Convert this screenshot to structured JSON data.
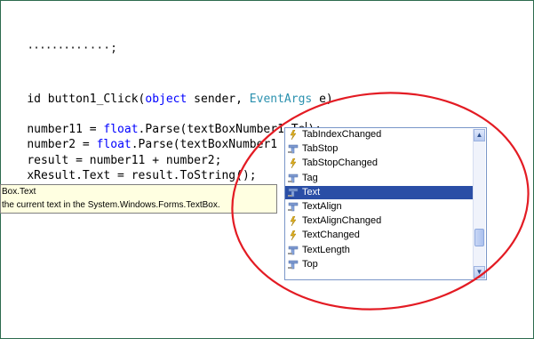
{
  "editor": {
    "line0": "  ",
    "line1_prefix": "id ",
    "line1_name": "button1_Click(",
    "line1_kw": "object",
    "line1_mid": " sender, ",
    "line1_type": "EventArgs",
    "line1_end": " e)",
    "line2_a": "number11 = ",
    "line2_kw": "float",
    "line2_b": ".Parse(textBoxNumber1.Te",
    "line2_c": ");",
    "line3_a": "number2 = ",
    "line3_kw": "float",
    "line3_b": ".Parse(textBoxNumber1",
    "line4": "result = number11 + number2;",
    "line5": "xResult.Text = result.ToString();"
  },
  "tooltip": {
    "title": "Box.Text",
    "description": "the current text in the System.Windows.Forms.TextBox."
  },
  "intellisense": {
    "items": [
      {
        "label": "TabIndexChanged",
        "icon": "event-icon",
        "selected": false
      },
      {
        "label": "TabStop",
        "icon": "property-icon",
        "selected": false
      },
      {
        "label": "TabStopChanged",
        "icon": "event-icon",
        "selected": false
      },
      {
        "label": "Tag",
        "icon": "property-icon",
        "selected": false
      },
      {
        "label": "Text",
        "icon": "property-icon",
        "selected": true
      },
      {
        "label": "TextAlign",
        "icon": "property-icon",
        "selected": false
      },
      {
        "label": "TextAlignChanged",
        "icon": "event-icon",
        "selected": false
      },
      {
        "label": "TextChanged",
        "icon": "event-icon",
        "selected": false
      },
      {
        "label": "TextLength",
        "icon": "property-icon",
        "selected": false
      },
      {
        "label": "Top",
        "icon": "property-icon",
        "selected": false
      }
    ],
    "scroll_up_glyph": "▲",
    "scroll_down_glyph": "▼"
  },
  "colors": {
    "keyword": "#0000ff",
    "type": "#2b91af",
    "selection": "#2a4ea6",
    "annotation_circle": "#e31b23",
    "tooltip_bg": "#ffffe1"
  }
}
